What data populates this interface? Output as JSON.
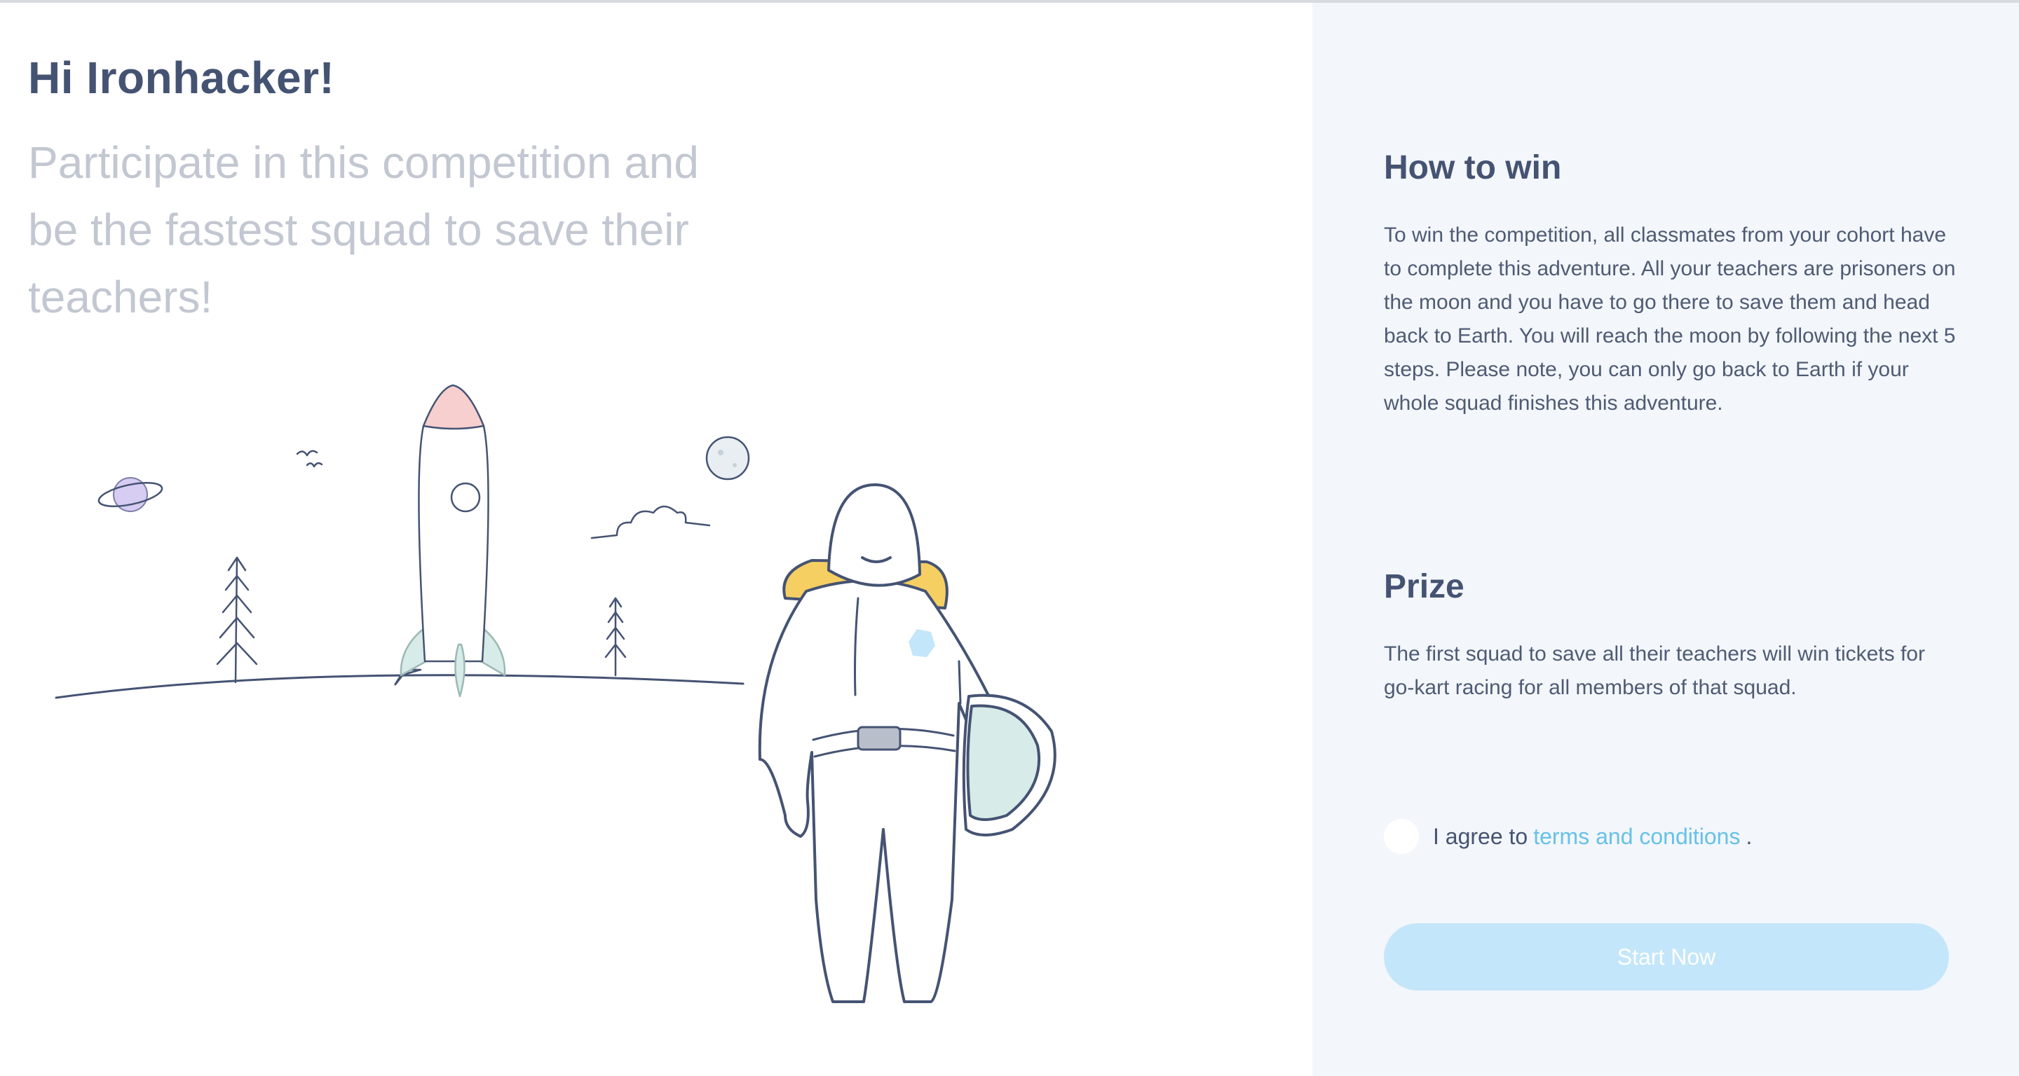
{
  "left": {
    "greeting": "Hi Ironhacker!",
    "tagline": "Participate in this competition and be the fastest squad to save their teachers!"
  },
  "how_to_win": {
    "title": "How to win",
    "text": "To win the competition, all classmates from your cohort have to complete this adventure. All your teachers are prisoners on the moon and you have to go there to save them and head back to Earth. You will reach the moon by following the next 5 steps. Please note, you can only go back to Earth if your whole squad finishes this adventure."
  },
  "prize": {
    "title": "Prize",
    "text": "The first squad to save all their teachers will win tickets for go-kart racing for all members of that squad."
  },
  "agreement": {
    "prefix": "I agree to",
    "link": "terms and conditions",
    "suffix": ".",
    "checked": false
  },
  "cta": {
    "label": "Start Now",
    "disabled": true
  },
  "colors": {
    "heading": "#455373",
    "muted": "#c2c7d1",
    "panel_bg": "#f3f6fa",
    "link": "#67c1e8",
    "button_bg": "#c4e6fa"
  },
  "illustration": {
    "icons": [
      "planet-icon",
      "birds-icon",
      "rocket-icon",
      "moon-icon",
      "cloud-icon",
      "tree-icon",
      "astronaut-icon",
      "helmet-icon"
    ]
  }
}
